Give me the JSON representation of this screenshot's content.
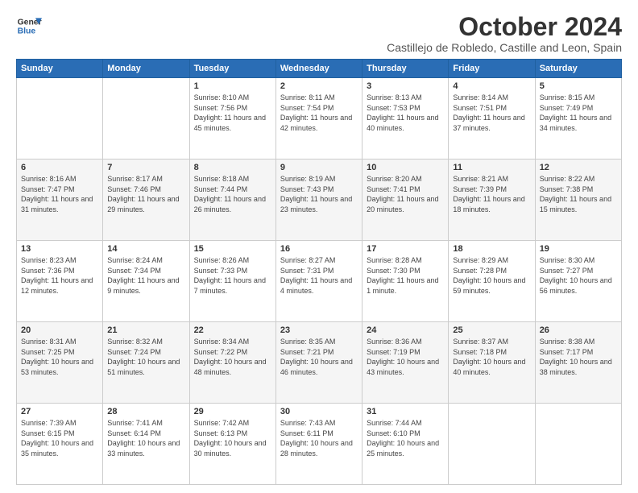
{
  "logo": {
    "line1": "General",
    "line2": "Blue"
  },
  "title": "October 2024",
  "subtitle": "Castillejo de Robledo, Castille and Leon, Spain",
  "days_of_week": [
    "Sunday",
    "Monday",
    "Tuesday",
    "Wednesday",
    "Thursday",
    "Friday",
    "Saturday"
  ],
  "weeks": [
    [
      {
        "day": "",
        "info": ""
      },
      {
        "day": "",
        "info": ""
      },
      {
        "day": "1",
        "info": "Sunrise: 8:10 AM\nSunset: 7:56 PM\nDaylight: 11 hours and 45 minutes."
      },
      {
        "day": "2",
        "info": "Sunrise: 8:11 AM\nSunset: 7:54 PM\nDaylight: 11 hours and 42 minutes."
      },
      {
        "day": "3",
        "info": "Sunrise: 8:13 AM\nSunset: 7:53 PM\nDaylight: 11 hours and 40 minutes."
      },
      {
        "day": "4",
        "info": "Sunrise: 8:14 AM\nSunset: 7:51 PM\nDaylight: 11 hours and 37 minutes."
      },
      {
        "day": "5",
        "info": "Sunrise: 8:15 AM\nSunset: 7:49 PM\nDaylight: 11 hours and 34 minutes."
      }
    ],
    [
      {
        "day": "6",
        "info": "Sunrise: 8:16 AM\nSunset: 7:47 PM\nDaylight: 11 hours and 31 minutes."
      },
      {
        "day": "7",
        "info": "Sunrise: 8:17 AM\nSunset: 7:46 PM\nDaylight: 11 hours and 29 minutes."
      },
      {
        "day": "8",
        "info": "Sunrise: 8:18 AM\nSunset: 7:44 PM\nDaylight: 11 hours and 26 minutes."
      },
      {
        "day": "9",
        "info": "Sunrise: 8:19 AM\nSunset: 7:43 PM\nDaylight: 11 hours and 23 minutes."
      },
      {
        "day": "10",
        "info": "Sunrise: 8:20 AM\nSunset: 7:41 PM\nDaylight: 11 hours and 20 minutes."
      },
      {
        "day": "11",
        "info": "Sunrise: 8:21 AM\nSunset: 7:39 PM\nDaylight: 11 hours and 18 minutes."
      },
      {
        "day": "12",
        "info": "Sunrise: 8:22 AM\nSunset: 7:38 PM\nDaylight: 11 hours and 15 minutes."
      }
    ],
    [
      {
        "day": "13",
        "info": "Sunrise: 8:23 AM\nSunset: 7:36 PM\nDaylight: 11 hours and 12 minutes."
      },
      {
        "day": "14",
        "info": "Sunrise: 8:24 AM\nSunset: 7:34 PM\nDaylight: 11 hours and 9 minutes."
      },
      {
        "day": "15",
        "info": "Sunrise: 8:26 AM\nSunset: 7:33 PM\nDaylight: 11 hours and 7 minutes."
      },
      {
        "day": "16",
        "info": "Sunrise: 8:27 AM\nSunset: 7:31 PM\nDaylight: 11 hours and 4 minutes."
      },
      {
        "day": "17",
        "info": "Sunrise: 8:28 AM\nSunset: 7:30 PM\nDaylight: 11 hours and 1 minute."
      },
      {
        "day": "18",
        "info": "Sunrise: 8:29 AM\nSunset: 7:28 PM\nDaylight: 10 hours and 59 minutes."
      },
      {
        "day": "19",
        "info": "Sunrise: 8:30 AM\nSunset: 7:27 PM\nDaylight: 10 hours and 56 minutes."
      }
    ],
    [
      {
        "day": "20",
        "info": "Sunrise: 8:31 AM\nSunset: 7:25 PM\nDaylight: 10 hours and 53 minutes."
      },
      {
        "day": "21",
        "info": "Sunrise: 8:32 AM\nSunset: 7:24 PM\nDaylight: 10 hours and 51 minutes."
      },
      {
        "day": "22",
        "info": "Sunrise: 8:34 AM\nSunset: 7:22 PM\nDaylight: 10 hours and 48 minutes."
      },
      {
        "day": "23",
        "info": "Sunrise: 8:35 AM\nSunset: 7:21 PM\nDaylight: 10 hours and 46 minutes."
      },
      {
        "day": "24",
        "info": "Sunrise: 8:36 AM\nSunset: 7:19 PM\nDaylight: 10 hours and 43 minutes."
      },
      {
        "day": "25",
        "info": "Sunrise: 8:37 AM\nSunset: 7:18 PM\nDaylight: 10 hours and 40 minutes."
      },
      {
        "day": "26",
        "info": "Sunrise: 8:38 AM\nSunset: 7:17 PM\nDaylight: 10 hours and 38 minutes."
      }
    ],
    [
      {
        "day": "27",
        "info": "Sunrise: 7:39 AM\nSunset: 6:15 PM\nDaylight: 10 hours and 35 minutes."
      },
      {
        "day": "28",
        "info": "Sunrise: 7:41 AM\nSunset: 6:14 PM\nDaylight: 10 hours and 33 minutes."
      },
      {
        "day": "29",
        "info": "Sunrise: 7:42 AM\nSunset: 6:13 PM\nDaylight: 10 hours and 30 minutes."
      },
      {
        "day": "30",
        "info": "Sunrise: 7:43 AM\nSunset: 6:11 PM\nDaylight: 10 hours and 28 minutes."
      },
      {
        "day": "31",
        "info": "Sunrise: 7:44 AM\nSunset: 6:10 PM\nDaylight: 10 hours and 25 minutes."
      },
      {
        "day": "",
        "info": ""
      },
      {
        "day": "",
        "info": ""
      }
    ]
  ]
}
